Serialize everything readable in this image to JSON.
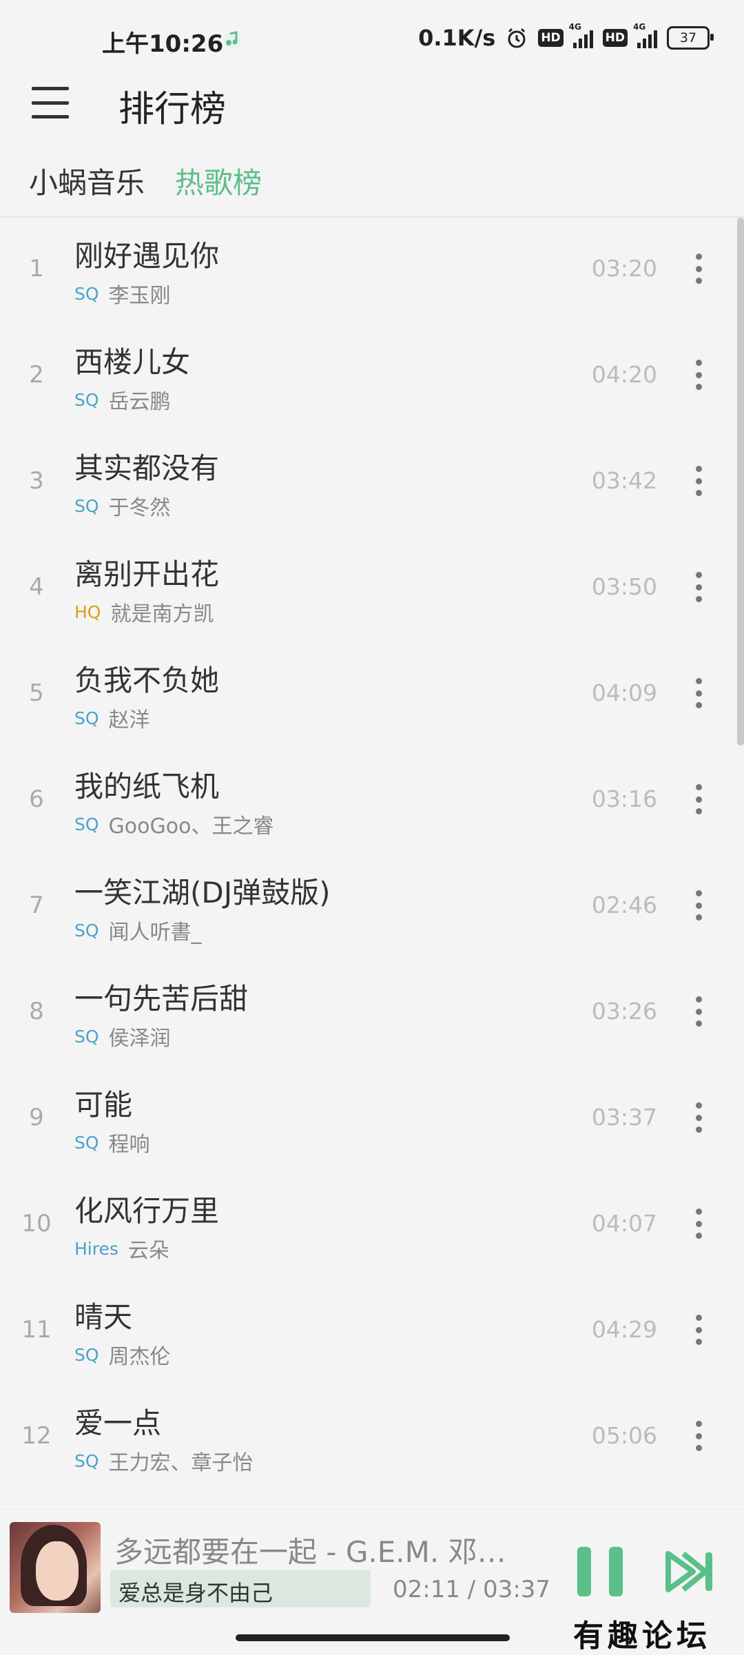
{
  "status_bar": {
    "time": "上午10:26",
    "net_speed": "0.1K/s",
    "hd1": "HD",
    "hd2": "HD",
    "net1": "4G",
    "net2": "4G",
    "battery": "37"
  },
  "header": {
    "title": "排行榜"
  },
  "tabs": [
    {
      "label": "小蜗音乐",
      "active": false
    },
    {
      "label": "热歌榜",
      "active": true
    }
  ],
  "colors": {
    "accent": "#5bbf8a",
    "sq": "#4aa3c8",
    "hq": "#d4a019"
  },
  "songs": [
    {
      "rank": "1",
      "title": "刚好遇见你",
      "quality": "SQ",
      "artist": "李玉刚",
      "duration": "03:20"
    },
    {
      "rank": "2",
      "title": "西楼儿女",
      "quality": "SQ",
      "artist": "岳云鹏",
      "duration": "04:20"
    },
    {
      "rank": "3",
      "title": "其实都没有",
      "quality": "SQ",
      "artist": "于冬然",
      "duration": "03:42"
    },
    {
      "rank": "4",
      "title": "离别开出花",
      "quality": "HQ",
      "artist": "就是南方凯",
      "duration": "03:50"
    },
    {
      "rank": "5",
      "title": "负我不负她",
      "quality": "SQ",
      "artist": "赵洋",
      "duration": "04:09"
    },
    {
      "rank": "6",
      "title": "我的纸飞机",
      "quality": "SQ",
      "artist": "GooGoo、王之睿",
      "duration": "03:16"
    },
    {
      "rank": "7",
      "title": "一笑江湖(DJ弹鼓版)",
      "quality": "SQ",
      "artist": "闻人听書_",
      "duration": "02:46"
    },
    {
      "rank": "8",
      "title": "一句先苦后甜",
      "quality": "SQ",
      "artist": "侯泽润",
      "duration": "03:26"
    },
    {
      "rank": "9",
      "title": "可能",
      "quality": "SQ",
      "artist": "程响",
      "duration": "03:37"
    },
    {
      "rank": "10",
      "title": "化风行万里",
      "quality": "Hires",
      "artist": "云朵",
      "duration": "04:07"
    },
    {
      "rank": "11",
      "title": "晴天",
      "quality": "SQ",
      "artist": "周杰伦",
      "duration": "04:29"
    },
    {
      "rank": "12",
      "title": "爱一点",
      "quality": "SQ",
      "artist": "王力宏、章子怡",
      "duration": "05:06"
    }
  ],
  "player": {
    "now_playing": "多远都要在一起 - G.E.M. 邓…",
    "lyric": "爱总是身不由己",
    "time": "02:11 / 03:37",
    "state": "playing"
  },
  "watermark": "有趣论坛"
}
